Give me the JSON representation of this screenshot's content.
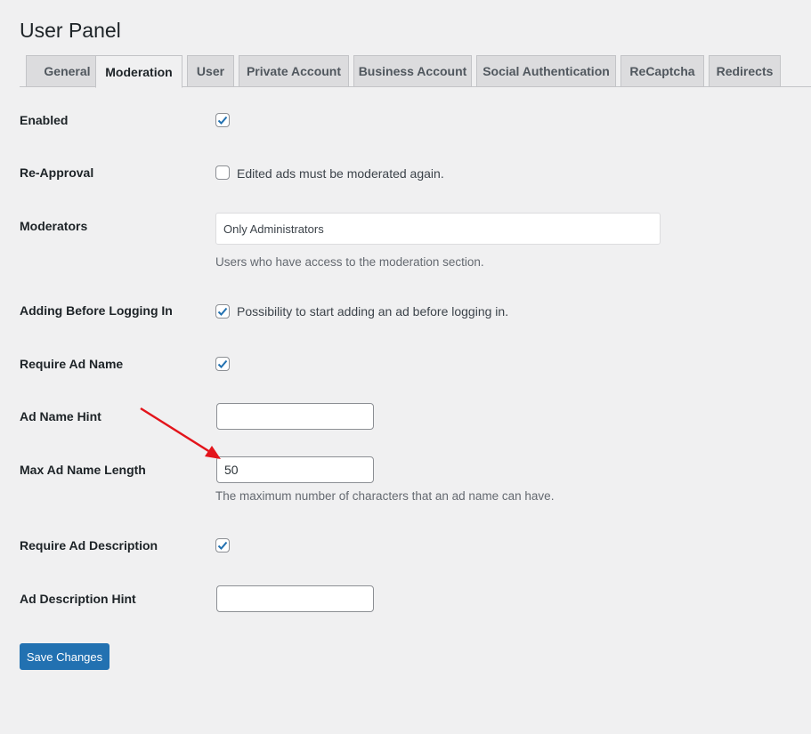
{
  "page": {
    "title": "User Panel"
  },
  "tabs": [
    {
      "label": "General"
    },
    {
      "label": "Moderation"
    },
    {
      "label": "User"
    },
    {
      "label": "Private Account"
    },
    {
      "label": "Business Account"
    },
    {
      "label": "Social Authentication"
    },
    {
      "label": "ReCaptcha"
    },
    {
      "label": "Redirects"
    }
  ],
  "active_tab": "Moderation",
  "settings": {
    "enabled": {
      "label": "Enabled",
      "checked": true
    },
    "re_approval": {
      "label": "Re-Approval",
      "checked": false,
      "option_text": "Edited ads must be moderated again."
    },
    "moderators": {
      "label": "Moderators",
      "value": "Only Administrators",
      "description": "Users who have access to the moderation section."
    },
    "adding_before_login": {
      "label": "Adding Before Logging In",
      "checked": true,
      "option_text": "Possibility to start adding an ad before logging in."
    },
    "require_ad_name": {
      "label": "Require Ad Name",
      "checked": true
    },
    "ad_name_hint": {
      "label": "Ad Name Hint",
      "value": ""
    },
    "max_ad_name_length": {
      "label": "Max Ad Name Length",
      "value": "50",
      "description": "The maximum number of characters that an ad name can have."
    },
    "require_ad_description": {
      "label": "Require Ad Description",
      "checked": true
    },
    "ad_description_hint": {
      "label": "Ad Description Hint",
      "value": ""
    }
  },
  "actions": {
    "save_label": "Save Changes"
  },
  "colors": {
    "accent": "#2271b1",
    "annotation_arrow": "#e3141b"
  }
}
